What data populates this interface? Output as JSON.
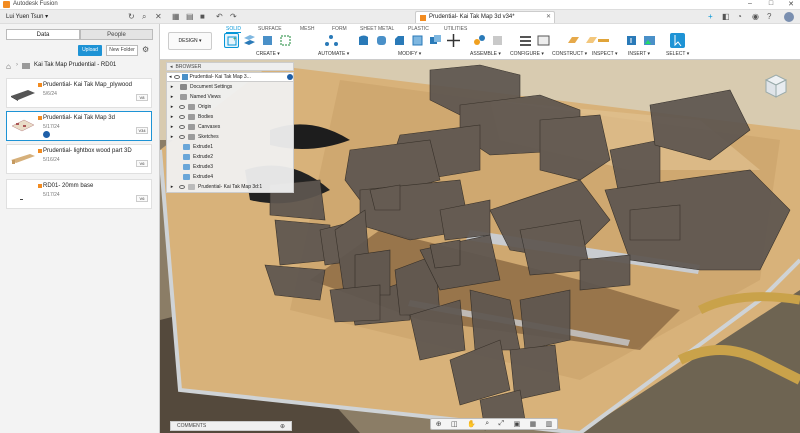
{
  "app": {
    "title": "Autodesk Fusion",
    "doc_tab": "Prudential- Kai Tak Map 3d v34*"
  },
  "user": {
    "name": "Lui Yuen Tsun"
  },
  "data_panel": {
    "tabs": [
      "Data",
      "People"
    ],
    "upload_label": "Upload",
    "new_folder_label": "New Folder",
    "breadcrumb": "Kai Tak Map Prudential - RD01",
    "files": [
      {
        "name": "Prudential- Kai Tak Map_plywood",
        "date": "5/6/24",
        "version": "V8"
      },
      {
        "name": "Prudential- Kai Tak Map 3d",
        "date": "5/17/24",
        "version": "V34"
      },
      {
        "name": "Prudential- lightbox wood part 3D",
        "date": "5/16/24",
        "version": "V6"
      },
      {
        "name": "RD01- 20mm base",
        "date": "5/17/24",
        "version": "V6"
      }
    ]
  },
  "ribbon": {
    "workspace": "DESIGN",
    "tabs": [
      "SOLID",
      "SURFACE",
      "MESH",
      "FORM",
      "SHEET METAL",
      "PLASTIC",
      "UTILITIES"
    ],
    "groups": [
      "CREATE",
      "AUTOMATE",
      "MODIFY",
      "ASSEMBLE",
      "CONFIGURE",
      "CONSTRUCT",
      "INSPECT",
      "INSERT",
      "SELECT"
    ]
  },
  "browser": {
    "header": "BROWSER",
    "root": "Prudential- Kai Tak Map 3...",
    "items": [
      "Document Settings",
      "Named Views",
      "Origin",
      "Bodies",
      "Canvases",
      "Sketches",
      "Extrude1",
      "Extrude2",
      "Extrude3",
      "Extrude4",
      "Prudential- Kai Tak Map 3d:1"
    ]
  },
  "comments": {
    "label": "COMMENTS"
  },
  "colors": {
    "accent": "#0696d7",
    "wood": "#d8b27a",
    "blocks": "#5e5650"
  }
}
